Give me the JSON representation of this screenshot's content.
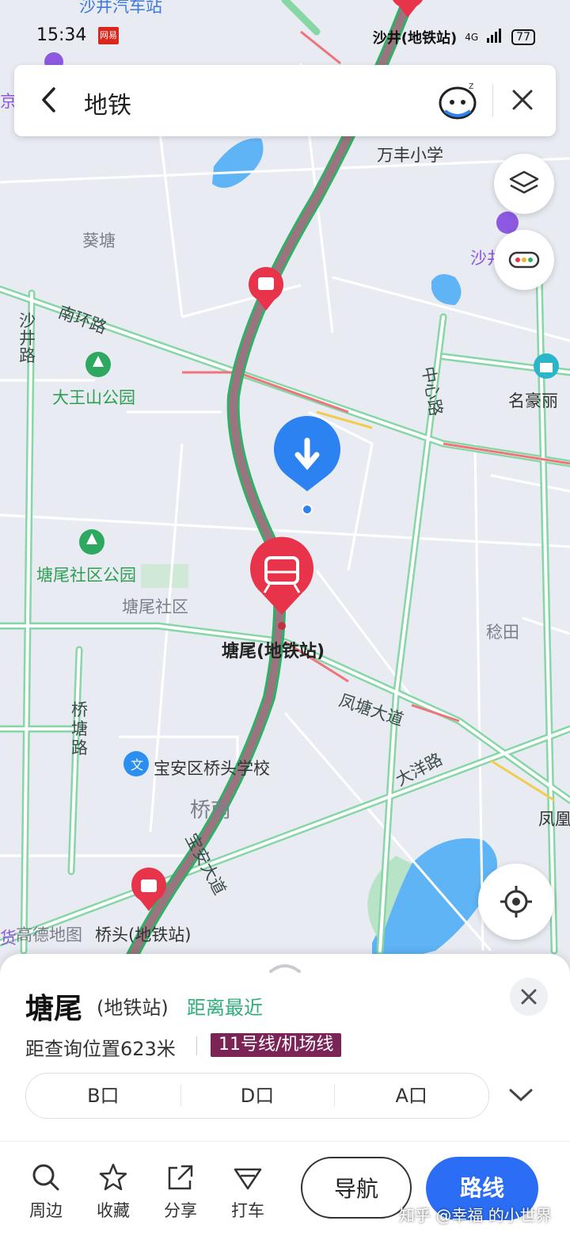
{
  "status": {
    "time": "15:34",
    "app_badge": "网易",
    "network": "4G",
    "battery": "77"
  },
  "search": {
    "query": "地铁"
  },
  "map": {
    "labels": {
      "top_station": "沙井汽车站",
      "overlay_station": "沙井(地铁站)",
      "wanfeng_school": "万丰小学",
      "kuitang": "葵塘",
      "nanhuan_road": "南环路",
      "shajing_road": "沙井路",
      "dawangshan_park": "大王山公园",
      "zhongxin_road": "中心路",
      "minghao": "名豪丽",
      "tangwei_park": "塘尾社区公园",
      "tangwei_community": "塘尾社区",
      "tangwei_station": "塘尾(地铁站)",
      "wentian": "稔田",
      "fengtang_road": "凤塘大道",
      "qiaotang_road": "桥塘路",
      "qiaotou_school": "宝安区桥头学校",
      "dayang_road": "大洋路",
      "qiaonan": "桥南",
      "baoan_road": "宝安大道",
      "fenghuang": "凤凰",
      "amap_logo": "高德地图",
      "qiaotou_station": "桥头(地铁站)",
      "sha_partial": "沙井",
      "jing_partial": "京",
      "huo_partial": "货"
    }
  },
  "sheet": {
    "name": "塘尾",
    "type": "(地铁站)",
    "nearest": "距离最近",
    "distance": "距查询位置623米",
    "line": "11号线/机场线",
    "exits": [
      "B口",
      "D口",
      "A口"
    ],
    "actions": {
      "nearby": "周边",
      "favorite": "收藏",
      "share": "分享",
      "taxi": "打车"
    },
    "navigate": "导航",
    "route": "路线"
  },
  "watermark": "知乎 @幸福 的小世界",
  "colors": {
    "accent": "#2b6ef5",
    "station_red": "#e8344a",
    "line_badge": "#7b2456",
    "green_text": "#2fae79"
  }
}
